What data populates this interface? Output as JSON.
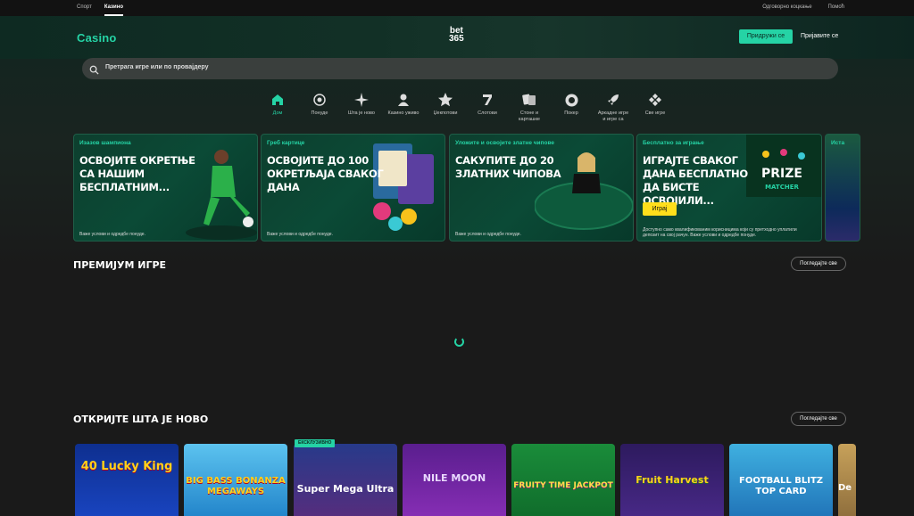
{
  "topbar": {
    "tabs": [
      {
        "label": "Спорт"
      },
      {
        "label": "Казино"
      }
    ],
    "links": [
      {
        "label": "Одговорно коцкање"
      },
      {
        "label": "Помоћ"
      }
    ]
  },
  "header": {
    "brand": "Casino",
    "logo_top": "bet",
    "logo_bottom": "365",
    "join_label": "Придружи се",
    "login_label": "Пријавите се"
  },
  "search": {
    "placeholder": "Претрага игре или по провајдеру"
  },
  "categories": [
    {
      "label": "Дом",
      "icon": "home-icon",
      "active": true
    },
    {
      "label": "Понуде",
      "icon": "offers-icon"
    },
    {
      "label": "Шта је ново",
      "icon": "sparkle-icon"
    },
    {
      "label": "Казино уживо",
      "icon": "dealer-icon"
    },
    {
      "label": "Џекпотови",
      "icon": "star-icon"
    },
    {
      "label": "Слотови",
      "icon": "seven-icon"
    },
    {
      "label": "Стоне и карташке",
      "icon": "cards-icon"
    },
    {
      "label": "Покер",
      "icon": "chip-icon"
    },
    {
      "label": "Аркадне игре и игре са",
      "icon": "rocket-icon"
    },
    {
      "label": "Све игре",
      "icon": "grid-icon"
    }
  ],
  "promos": [
    {
      "tag": "Изазов шампиона",
      "title": "ОСВОЈИТЕ ОКРЕТЊЕ СА НАШИМ БЕСПЛАТНИМ...",
      "terms": "Важе услови и одредбе понуде."
    },
    {
      "tag": "Греб картице",
      "title": "ОСВОЈИТЕ ДО 100 ОКРЕТЉАЈА СВАКОГ ДАНА",
      "terms": "Важе услови и одредбе понуде."
    },
    {
      "tag": "Уложите и освојите златне чипове",
      "title": "САКУПИТЕ ДО 20 ЗЛАТНИХ ЧИПОВА",
      "terms": "Важе услови и одредбе понуде."
    },
    {
      "tag": "Бесплатно за играње",
      "title": "ИГРАЈТЕ СВАКОГ ДАНА БЕСПЛАТНО ДА БИСТЕ ОСВОЈИЛИ...",
      "play_label": "Играј",
      "art_text_1": "PRIZE",
      "art_text_2": "MATCHER",
      "terms": "Доступно само квалификованим корисницима који су претходно уплатили депозит на свој рачун. Важе услови и одредбе понуде."
    },
    {
      "tag": "Иста"
    }
  ],
  "sections": {
    "premium": {
      "title": "ПРЕМИЈУМ ИГРЕ",
      "see_all": "Погледајте све"
    },
    "new": {
      "title": "ОТКРИЈТЕ ШТА ЈЕ НОВО",
      "see_all": "Погледајте све"
    }
  },
  "games": [
    {
      "title": "40 Lucky King"
    },
    {
      "title": "BIG BASS BONANZA MEGAWAYS"
    },
    {
      "title": "Super Mega Ultra",
      "badge": "ЕКСКЛУЗИВНО"
    },
    {
      "title": "NILE MOON"
    },
    {
      "title": "FRUITY TIME JACKPOT"
    },
    {
      "title": "Fruit Harvest"
    },
    {
      "title": "FOOTBALL BLITZ TOP CARD"
    },
    {
      "title": "De"
    }
  ]
}
